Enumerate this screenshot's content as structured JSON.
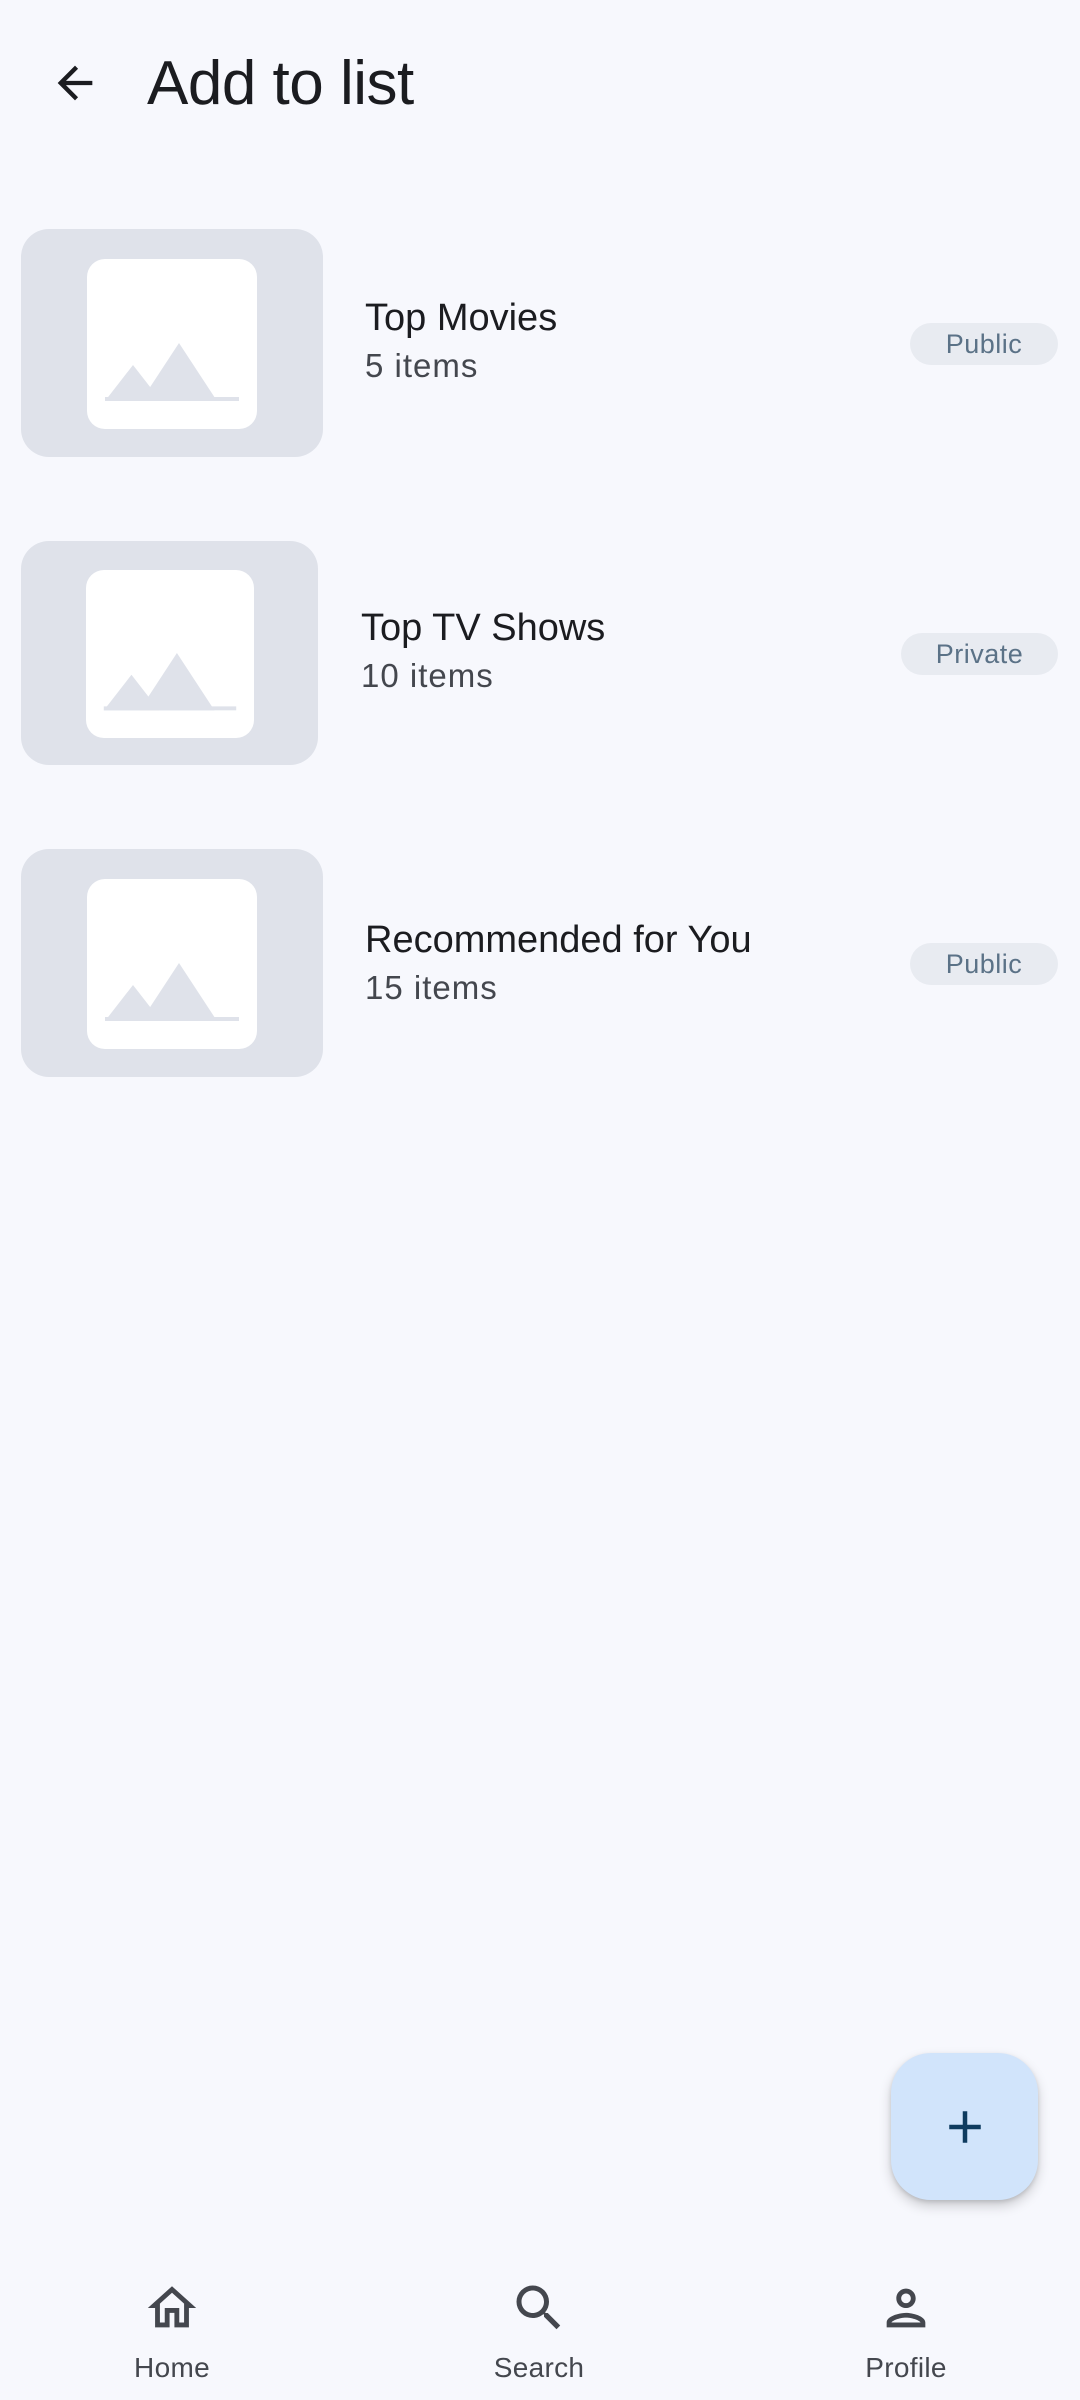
{
  "header": {
    "title": "Add to list",
    "back_icon": "arrow-left-icon"
  },
  "lists": [
    {
      "title": "Top Movies",
      "count": "5 items",
      "visibility": "Public",
      "thumbnail_icon": "image-placeholder-icon"
    },
    {
      "title": "Top TV Shows",
      "count": "10 items",
      "visibility": "Private",
      "thumbnail_icon": "image-placeholder-icon"
    },
    {
      "title": "Recommended for You",
      "count": "15 items",
      "visibility": "Public",
      "thumbnail_icon": "image-placeholder-icon"
    }
  ],
  "fab": {
    "icon": "plus-icon"
  },
  "bottom_nav": {
    "items": [
      {
        "label": "Home",
        "icon": "home-icon"
      },
      {
        "label": "Search",
        "icon": "search-icon"
      },
      {
        "label": "Profile",
        "icon": "person-icon"
      }
    ]
  },
  "colors": {
    "background": "#f7f8fd",
    "thumbnail_bg": "#dfe2ea",
    "badge_bg": "#e8ebf1",
    "badge_text": "#5b7287",
    "fab_bg": "#d1e4fb",
    "fab_icon": "#0e3b5f"
  }
}
